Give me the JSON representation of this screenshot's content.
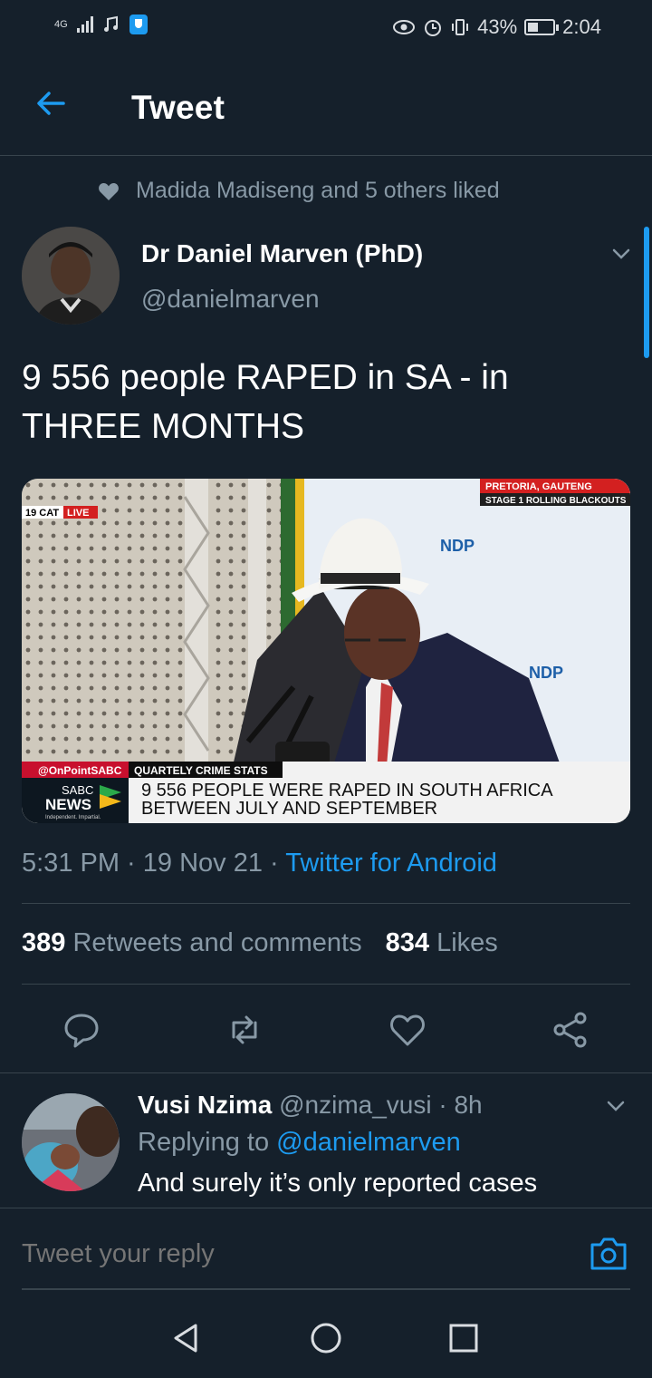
{
  "status_bar": {
    "network": "4G",
    "battery_percent": "43%",
    "battery_level": 0.43,
    "time": "2:04"
  },
  "header": {
    "title": "Tweet"
  },
  "social_context": {
    "text": "Madida Madiseng and 5 others liked"
  },
  "tweet": {
    "author_name": "Dr Daniel Marven (PhD)",
    "author_handle": "@danielmarven",
    "text": "9 556 people RAPED in SA - in THREE MONTHS",
    "timestamp": "5:31 PM · 19 Nov 21 · ",
    "source": "Twitter for Android",
    "retweets_count": "389",
    "retweets_label": "Retweets and comments",
    "likes_count": "834",
    "likes_label": "Likes"
  },
  "media": {
    "location": "PRETORIA, GAUTENG",
    "alert": "STAGE 1 ROLLING BLACKOUTS",
    "channel_code": "19 CAT",
    "live": "LIVE",
    "handle": "@OnPointSABC",
    "segment": "QUARTELY CRIME STATS",
    "headline_line1": "9 556 PEOPLE WERE RAPED IN SOUTH AFRICA",
    "headline_line2": "BETWEEN JULY AND SEPTEMBER",
    "brand_top": "SABC",
    "brand_bottom": "NEWS",
    "tagline": "Independent. Impartial.",
    "backdrop_logo": "NDP"
  },
  "reply": {
    "name": "Vusi Nzima",
    "handle_time": "@nzima_vusi · 8h",
    "replying_prefix": "Replying to",
    "replying_handle": "@danielmarven",
    "text": "And surely it’s only reported cases"
  },
  "composer": {
    "placeholder": "Tweet your reply"
  },
  "colors": {
    "background": "#15202b",
    "accent": "#1d9bf0",
    "secondary_text": "#8899a6",
    "divider": "#38444d"
  },
  "icons": [
    "back-arrow-icon",
    "heart-icon",
    "chevron-down-icon",
    "reply-icon",
    "retweet-icon",
    "like-icon",
    "share-icon",
    "camera-icon",
    "nav-back-icon",
    "nav-home-icon",
    "nav-recents-icon"
  ]
}
